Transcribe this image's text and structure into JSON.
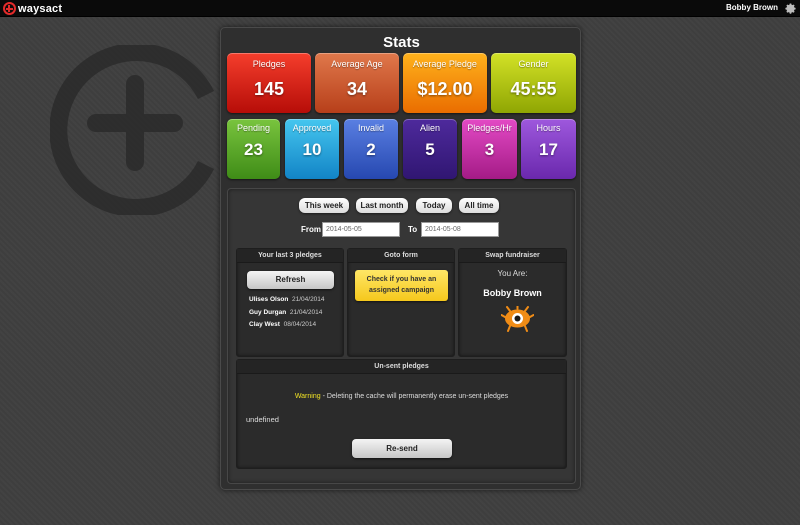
{
  "app": {
    "brand": "waysact",
    "user_name": "Bobby Brown"
  },
  "stats": {
    "title": "Stats",
    "tiles": [
      {
        "label": "Pledges",
        "value": "145"
      },
      {
        "label": "Average Age",
        "value": "34"
      },
      {
        "label": "Average Pledge",
        "value": "$12.00"
      },
      {
        "label": "Gender",
        "value": "45:55"
      },
      {
        "label": "Pending",
        "value": "23"
      },
      {
        "label": "Approved",
        "value": "10"
      },
      {
        "label": "Invalid",
        "value": "2"
      },
      {
        "label": "Alien",
        "value": "5"
      },
      {
        "label": "Pledges/Hr",
        "value": "3"
      },
      {
        "label": "Hours",
        "value": "17"
      }
    ]
  },
  "filters": {
    "ranges": [
      "This week",
      "Last month",
      "Today",
      "All time"
    ],
    "from_label": "From",
    "from_value": "2014-05-05",
    "to_label": "To",
    "to_value": "2014-05-08"
  },
  "last_pledges": {
    "title": "Your last 3 pledges",
    "refresh_label": "Refresh",
    "items": [
      {
        "name": "Ulises Olson",
        "date": "21/04/2014"
      },
      {
        "name": "Guy Durgan",
        "date": "21/04/2014"
      },
      {
        "name": "Clay West",
        "date": "08/04/2014"
      }
    ]
  },
  "goto_form": {
    "title": "Goto form",
    "button_line1": "Check if you have an",
    "button_line2": "assigned campaign"
  },
  "swap": {
    "title": "Swap fundraiser",
    "you_are": "You Are:",
    "name": "Bobby Brown"
  },
  "unsent": {
    "title": "Un-sent pledges",
    "warning_word": "Warning",
    "warning_text": " - Deleting the cache will permanently erase un-sent pledges",
    "status_text": "undefined",
    "resend_label": "Re-send"
  },
  "colors": {
    "brand_red": "#e32b2b",
    "background": "#3e3e3e",
    "warning_yellow": "#f0e224",
    "alien_orange": "#f08c16"
  },
  "icons": {
    "brand_logo": "waysact-logo-icon",
    "settings": "gear-icon",
    "watermark": "waysact-watermark-icon",
    "fundraiser_avatar": "alien-eye-icon"
  }
}
